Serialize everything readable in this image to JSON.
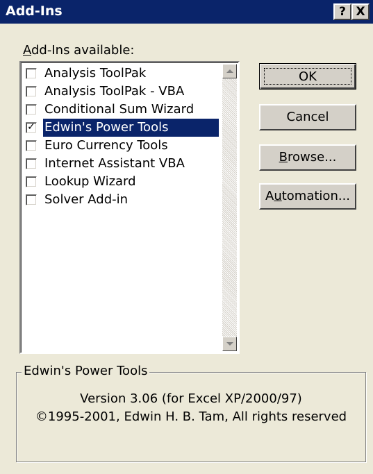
{
  "window": {
    "title": "Add-Ins",
    "help_glyph": "?",
    "close_glyph": "X"
  },
  "addins": {
    "label_prefix": "",
    "label_hotkey": "A",
    "label_rest": "dd-Ins available:",
    "items": [
      {
        "label": "Analysis ToolPak",
        "checked": false,
        "selected": false
      },
      {
        "label": "Analysis ToolPak - VBA",
        "checked": false,
        "selected": false
      },
      {
        "label": "Conditional Sum Wizard",
        "checked": false,
        "selected": false
      },
      {
        "label": "Edwin's Power Tools",
        "checked": true,
        "selected": true
      },
      {
        "label": "Euro Currency Tools",
        "checked": false,
        "selected": false
      },
      {
        "label": "Internet Assistant VBA",
        "checked": false,
        "selected": false
      },
      {
        "label": "Lookup Wizard",
        "checked": false,
        "selected": false
      },
      {
        "label": "Solver Add-in",
        "checked": false,
        "selected": false
      }
    ]
  },
  "buttons": {
    "ok": "OK",
    "cancel": "Cancel",
    "browse_hotkey": "B",
    "browse_rest": "rowse...",
    "automation_prefix": "A",
    "automation_hotkey": "u",
    "automation_rest": "tomation..."
  },
  "description": {
    "group_title": "Edwin's Power Tools",
    "line1": "Version 3.06 (for Excel XP/2000/97)",
    "line2": "©1995-2001, Edwin H. B. Tam, All rights reserved"
  },
  "colors": {
    "title_bar": "#0a246a",
    "dialog_face": "#ece9d8",
    "selection": "#0a246a"
  },
  "icons": {
    "help": "question-mark",
    "close": "x-mark",
    "scroll_up": "triangle-up",
    "scroll_down": "triangle-down",
    "check": "check-mark"
  }
}
